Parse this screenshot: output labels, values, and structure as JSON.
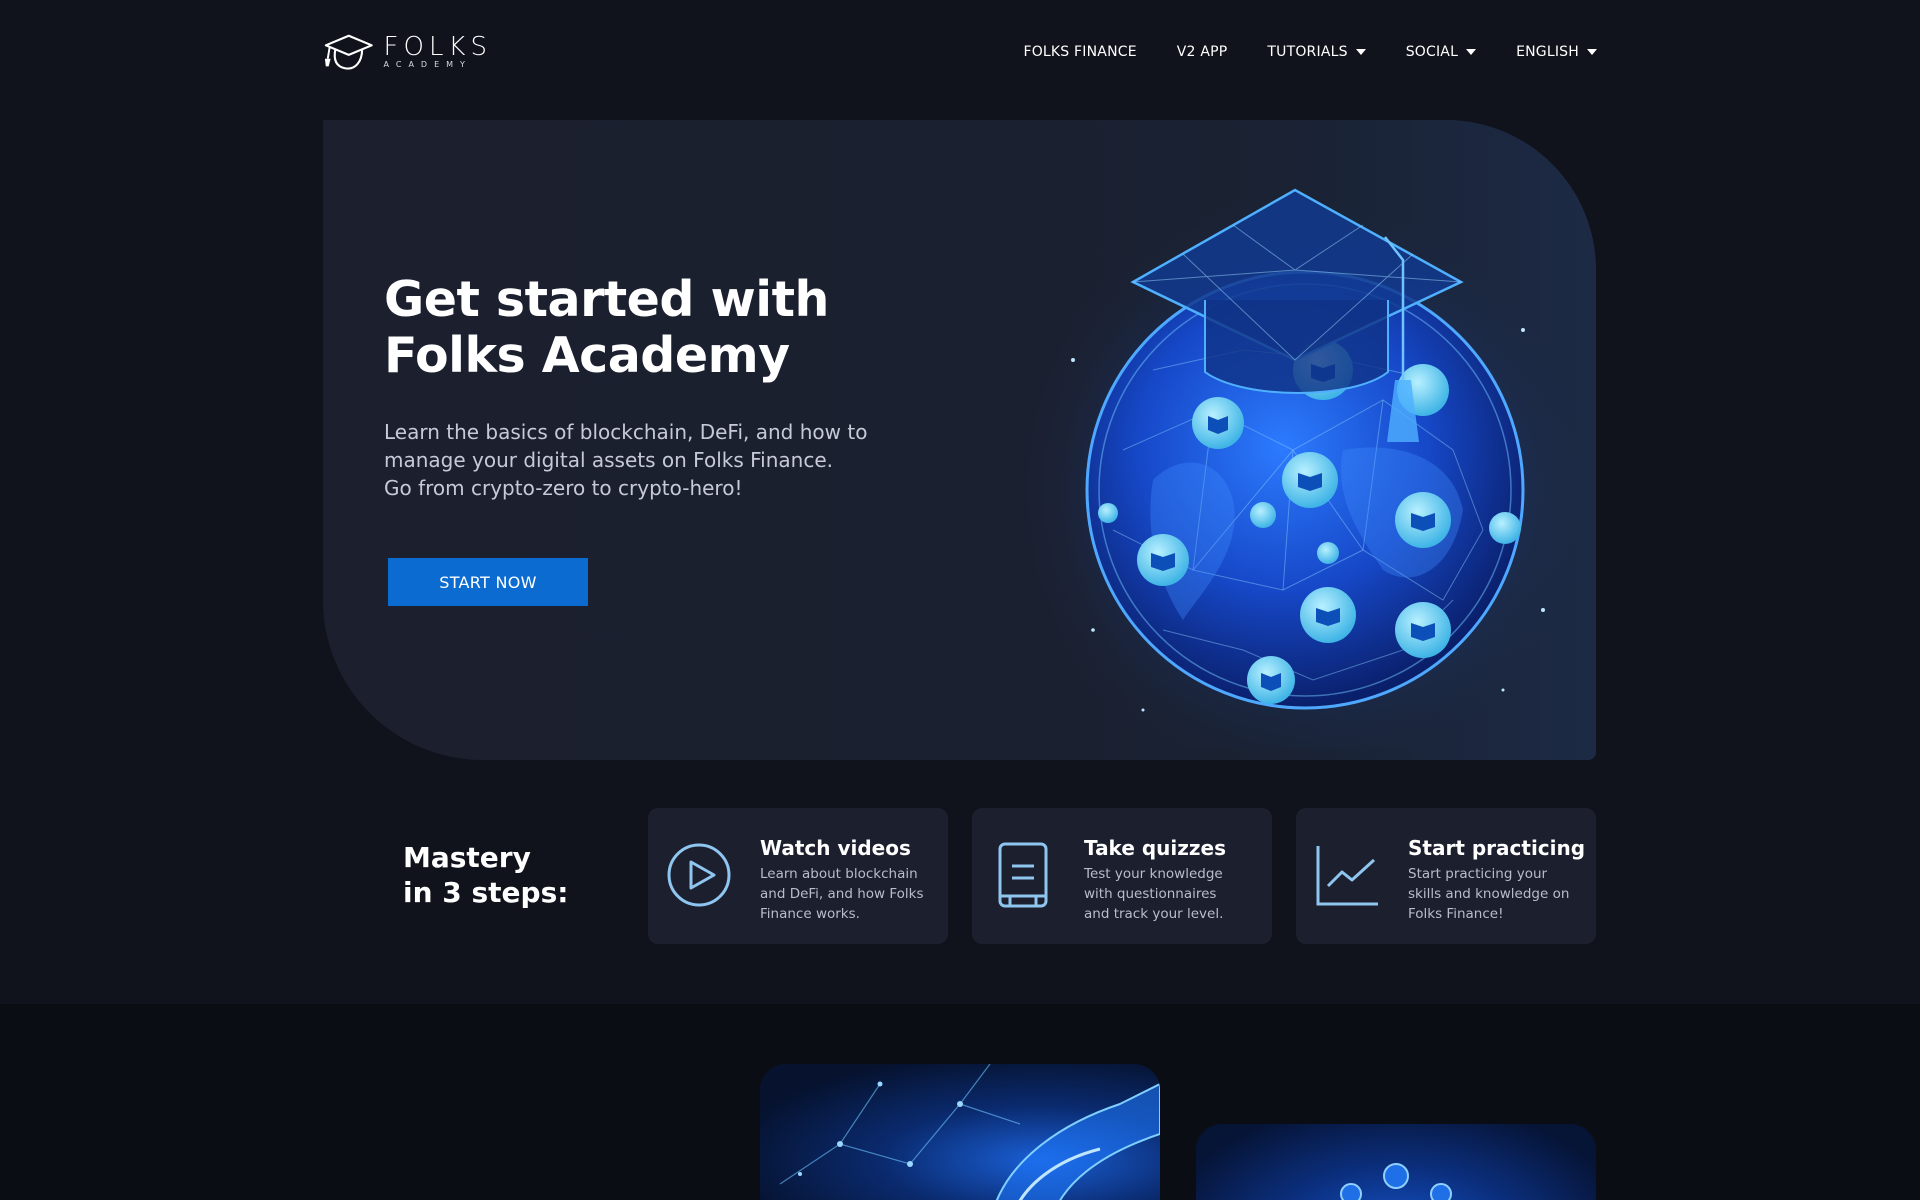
{
  "header": {
    "logo": {
      "main": "FOLKS",
      "sub": "ACADEMY"
    },
    "nav": [
      {
        "label": "FOLKS FINANCE",
        "dropdown": false
      },
      {
        "label": "V2 APP",
        "dropdown": false
      },
      {
        "label": "TUTORIALS",
        "dropdown": true
      },
      {
        "label": "SOCIAL",
        "dropdown": true
      },
      {
        "label": "ENGLISH",
        "dropdown": true
      }
    ]
  },
  "hero": {
    "title_line1": "Get started with",
    "title_line2": "Folks Academy",
    "desc_line1": "Learn the basics of blockchain, DeFi, and how to",
    "desc_line2": "manage your digital assets on Folks Finance.",
    "desc_line3": "Go from crypto-zero to crypto-hero!",
    "cta_label": "START NOW"
  },
  "steps": {
    "heading_line1": "Mastery",
    "heading_line2": "in 3 steps:",
    "items": [
      {
        "icon": "play-circle-icon",
        "title": "Watch videos",
        "desc": [
          "Learn about blockchain",
          "and DeFi, and how Folks",
          "Finance works."
        ]
      },
      {
        "icon": "quiz-document-icon",
        "title": "Take quizzes",
        "desc": [
          "Test your knowledge",
          "with questionnaires",
          "and track your level."
        ]
      },
      {
        "icon": "chart-line-icon",
        "title": "Start practicing",
        "desc": [
          "Start practicing your",
          "skills and knowledge on",
          "Folks Finance!"
        ]
      }
    ]
  },
  "colors": {
    "background": "#11131c",
    "hero_bg": "#1b1f2e",
    "accent": "#0c6bd0",
    "icon_stroke": "#8fc6f0",
    "card_bg": "#1c1f2e"
  }
}
